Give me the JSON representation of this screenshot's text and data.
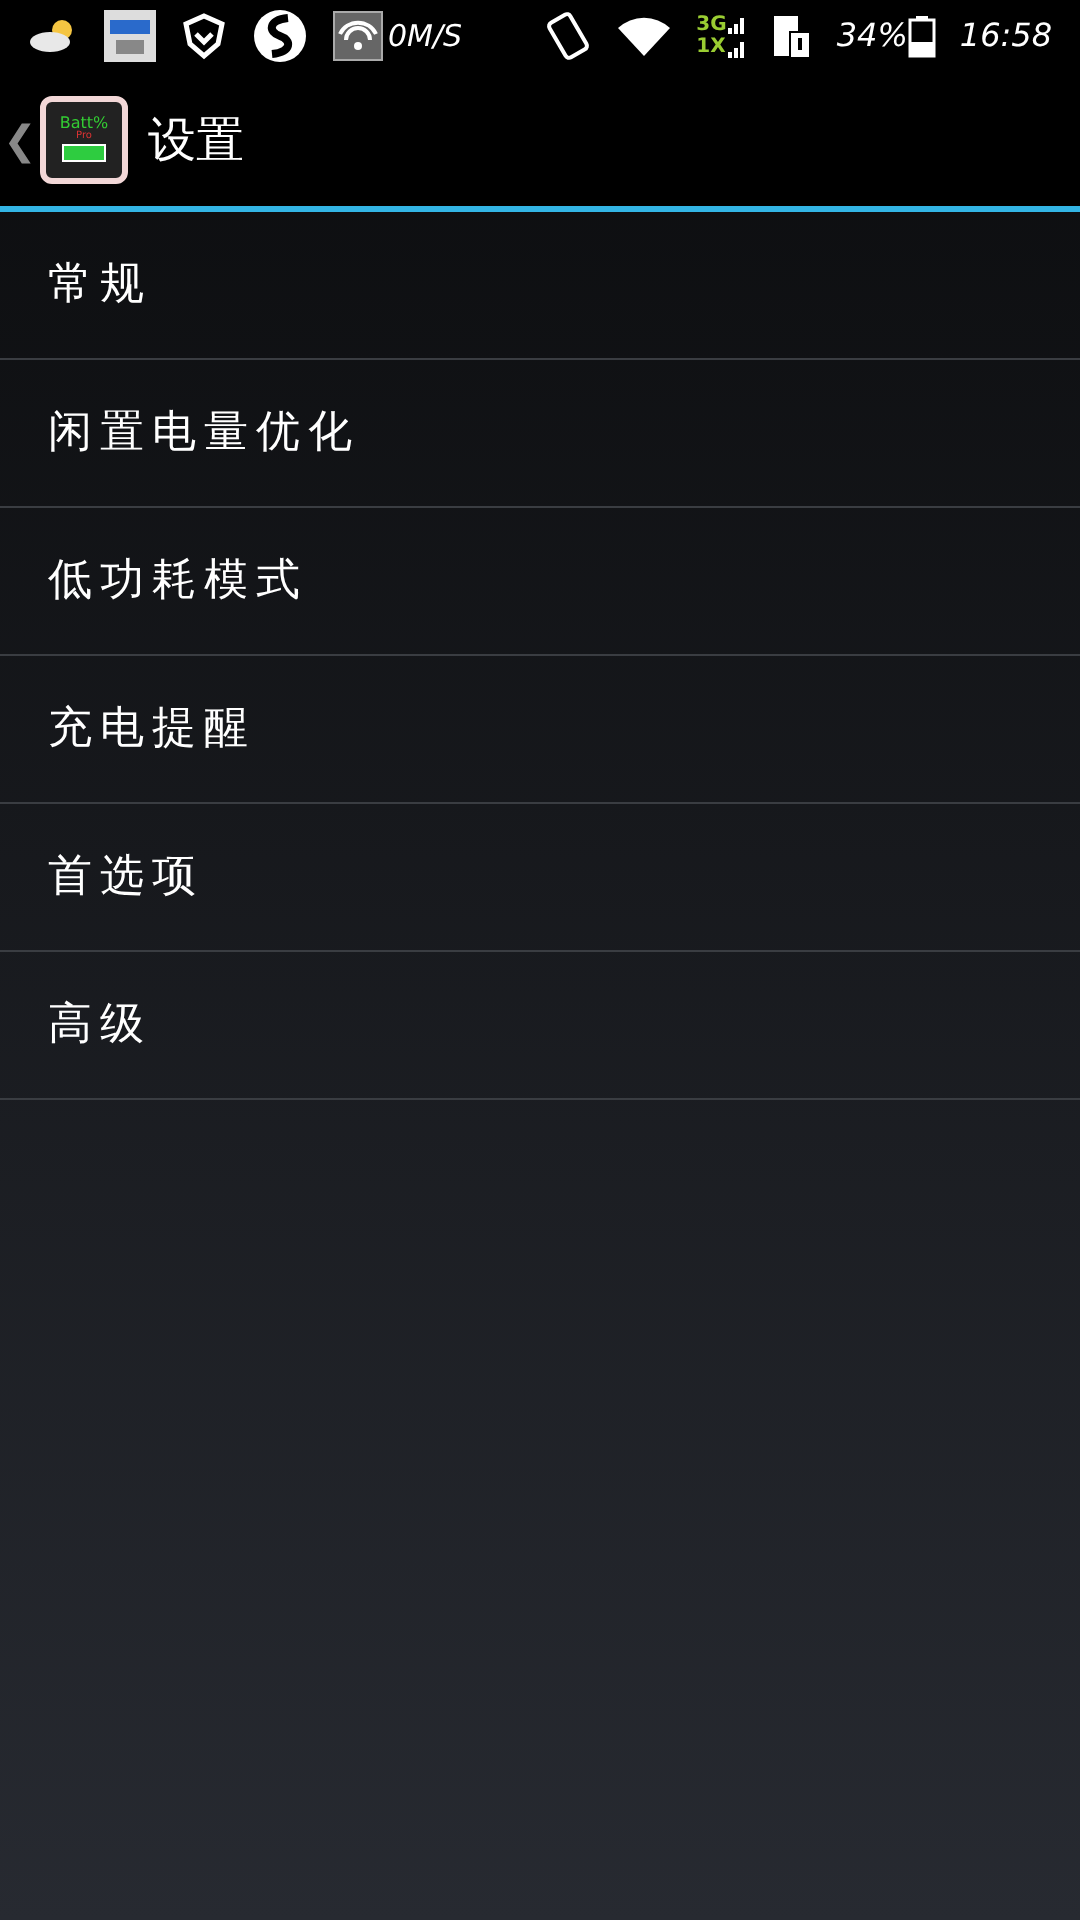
{
  "status_bar": {
    "speed": "0M/S",
    "network_top": "3G",
    "network_bottom": "1X",
    "battery": "34%",
    "time": "16:58"
  },
  "action_bar": {
    "back": "❮",
    "app_icon_label": "Batt%",
    "app_icon_sub": "Pro",
    "title": "设置"
  },
  "menu": [
    {
      "label": "常规"
    },
    {
      "label": "闲置电量优化"
    },
    {
      "label": "低功耗模式"
    },
    {
      "label": "充电提醒"
    },
    {
      "label": "首选项"
    },
    {
      "label": "高级"
    }
  ]
}
